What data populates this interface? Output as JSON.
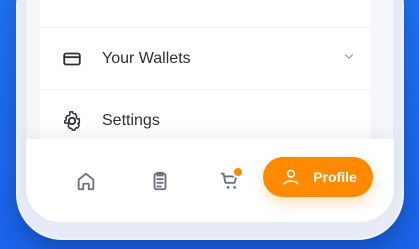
{
  "menu": {
    "items": [
      {
        "label": ""
      },
      {
        "label": "Your Wallets"
      },
      {
        "label": "Settings"
      }
    ]
  },
  "bottom_nav": {
    "profile_label": "Profile"
  },
  "colors": {
    "background_blue": "#1f72f4",
    "accent_orange": "#ff8a00",
    "surface": "#ffffff",
    "phone_frame": "#e7ebf6"
  },
  "icons": {
    "wallet": "wallet-icon",
    "settings": "settings-icon",
    "chevron": "chevron-down-icon",
    "home": "home-icon",
    "orders": "orders-icon",
    "cart": "cart-icon",
    "profile": "profile-icon"
  }
}
